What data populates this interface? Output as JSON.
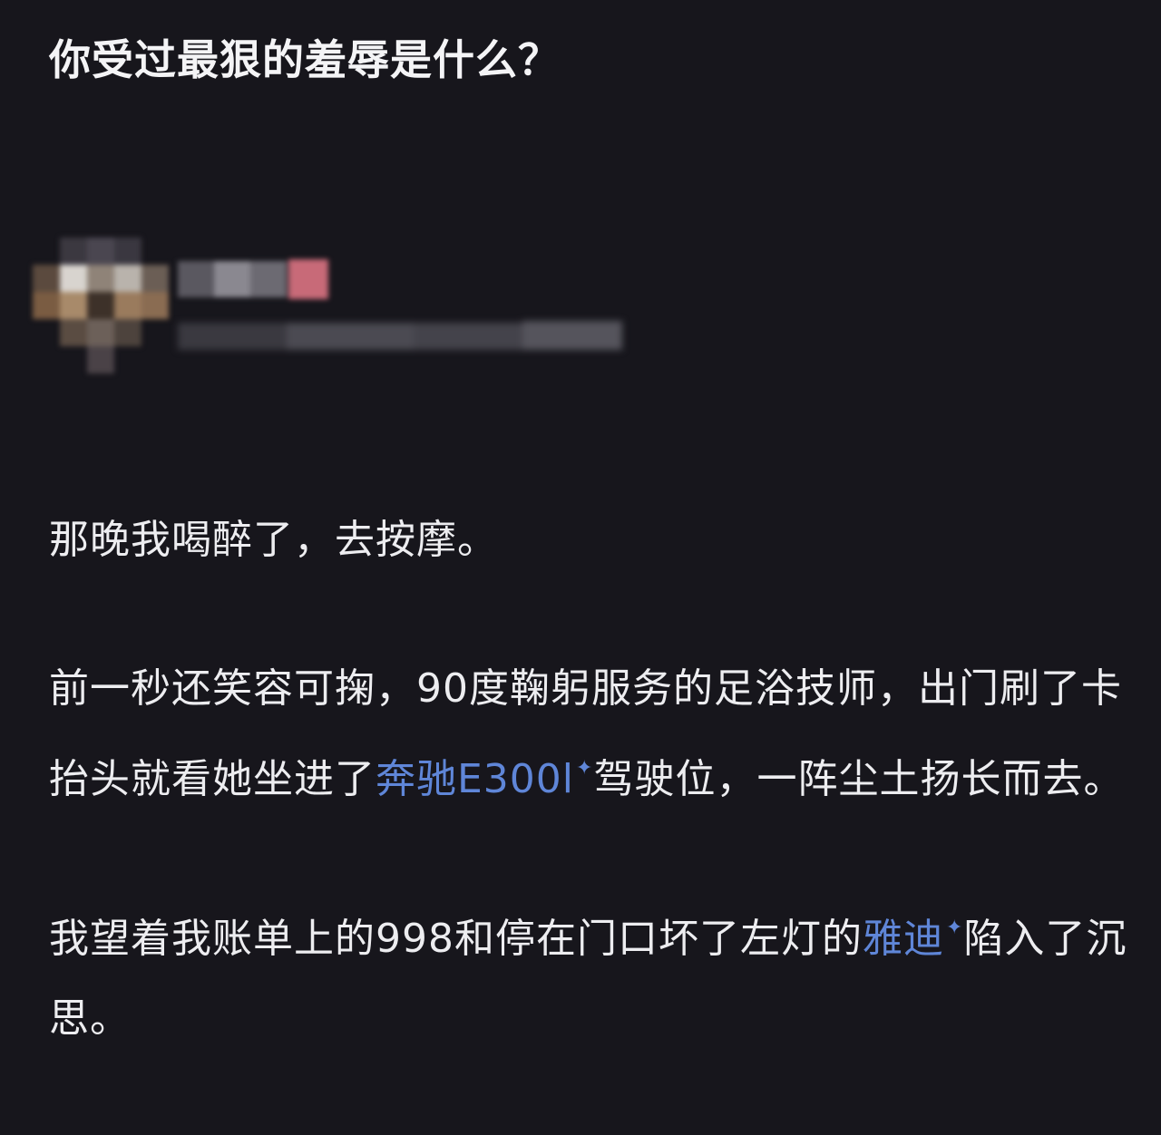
{
  "question": {
    "title": "你受过最狠的羞辱是什么？"
  },
  "author": {
    "avatar_icon": "avatar-pixelated",
    "name_censored": true,
    "meta_censored": true
  },
  "answer": {
    "p1": "那晚我喝醉了，去按摩。",
    "p2_a": "前一秒还笑容可掬，90度鞠躬服务的足浴技师，出门刷了卡抬头就看她坐进了",
    "p2_link": "奔驰E300l",
    "p2_b": "驾驶位，一阵尘土扬长而去。",
    "p3_a": "我望着我账单上的998和停在门口坏了左灯的",
    "p3_link": "雅迪",
    "p3_b": "陷入了沉思。",
    "link_icon": "sparkle-icon",
    "link_color": "#5f86d8"
  }
}
